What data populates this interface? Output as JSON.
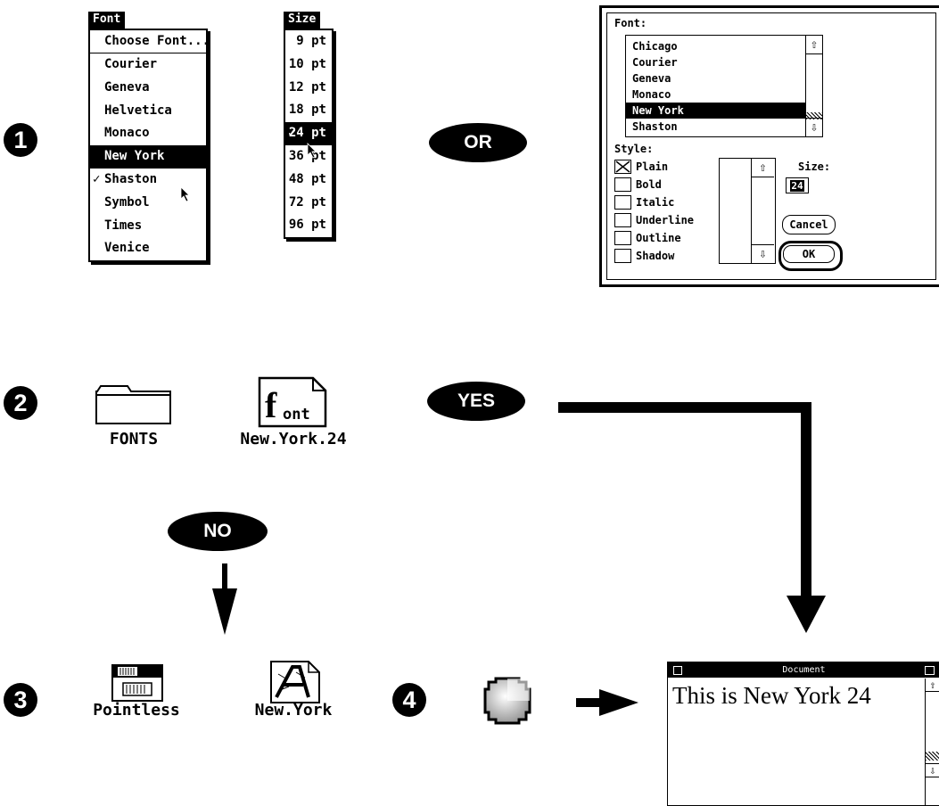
{
  "steps": [
    "1",
    "2",
    "3",
    "4"
  ],
  "pills": {
    "or": "OR",
    "yes": "YES",
    "no": "NO"
  },
  "font_menu": {
    "title": "Font",
    "items": [
      "Choose Font...",
      "Courier",
      "Geneva",
      "Helvetica",
      "Monaco",
      "New York",
      "Shaston",
      "Symbol",
      "Times",
      "Venice"
    ],
    "selected": "New York",
    "checked": "Shaston",
    "check_mark": "✓"
  },
  "size_menu": {
    "title": "Size",
    "items": [
      "9 pt",
      "10 pt",
      "12 pt",
      "18 pt",
      "24 pt",
      "36 pt",
      "48 pt",
      "72 pt",
      "96 pt"
    ],
    "selected": "24 pt",
    "check_mark": "✓"
  },
  "font_dialog": {
    "font_label": "Font:",
    "fonts": [
      "Chicago",
      "Courier",
      "Geneva",
      "Monaco",
      "New York",
      "Shaston"
    ],
    "selected_font": "New York",
    "style_label": "Style:",
    "styles": [
      "Plain",
      "Bold",
      "Italic",
      "Underline",
      "Outline",
      "Shadow"
    ],
    "checked_style": "Plain",
    "size_label": "Size:",
    "size_value": "24",
    "cancel": "Cancel",
    "ok": "OK",
    "up_arrow": "⇧",
    "down_arrow": "⇩"
  },
  "icons": {
    "fonts_folder": "FONTS",
    "font_file": "New.York.24",
    "font_file_glyph": "Font",
    "pointless": "Pointless",
    "new_york": "New.York"
  },
  "document": {
    "title": "Document",
    "text": "This is New York 24"
  }
}
